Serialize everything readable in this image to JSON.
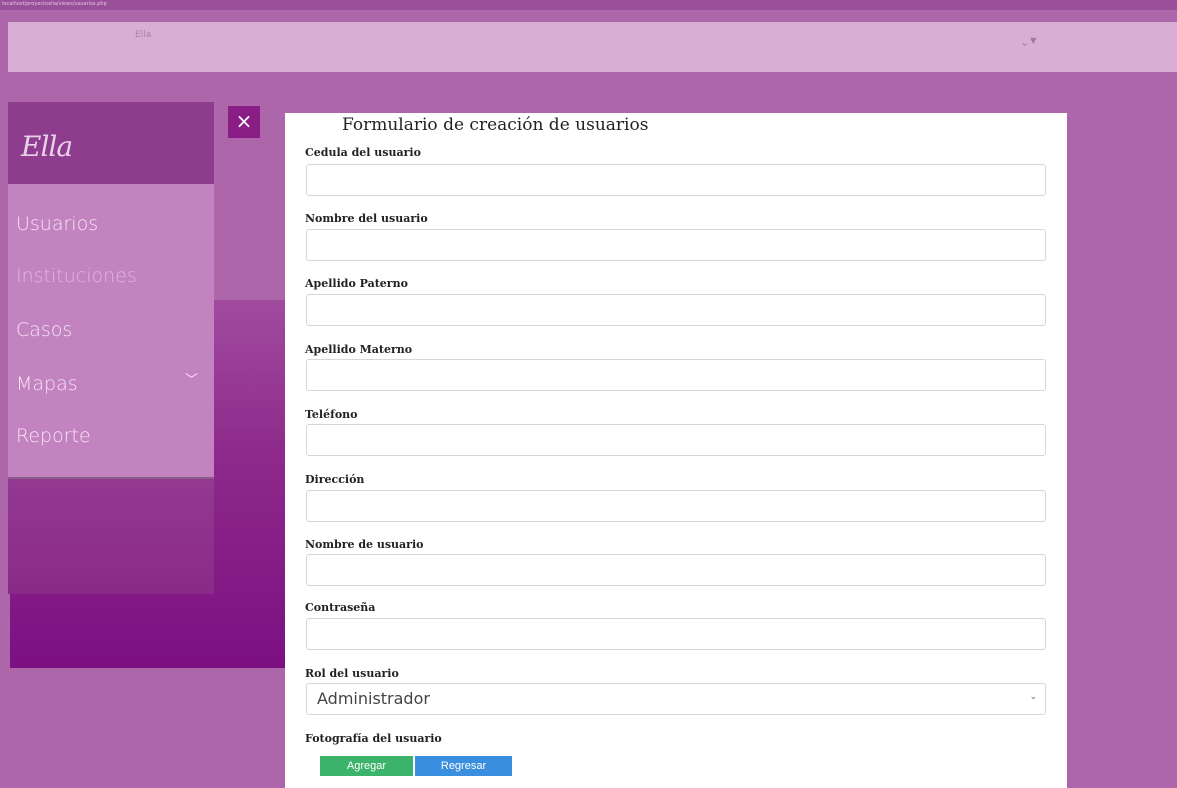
{
  "browser": {
    "url_text": "localhost/proyectoella/views/usuarios.php"
  },
  "header": {
    "brand_small": "Ella",
    "user_menu_icon": "chevron-down-icon",
    "user_menu_caret": "caret-down-icon"
  },
  "sidebar": {
    "logo": "Ella",
    "items": [
      {
        "label": "Usuarios"
      },
      {
        "label": "Instituciones"
      },
      {
        "label": "Casos"
      },
      {
        "label": "Mapas",
        "icon": "chevron-down-icon"
      },
      {
        "label": "Reporte"
      }
    ]
  },
  "close_button": {
    "icon": "close-icon",
    "glyph": "×"
  },
  "form": {
    "title": "Formulario de creación de usuarios",
    "fields": [
      {
        "label": "Cedula del usuario",
        "value": ""
      },
      {
        "label": "Nombre del usuario",
        "value": ""
      },
      {
        "label": "Apellido Paterno",
        "value": ""
      },
      {
        "label": "Apellido Materno",
        "value": ""
      },
      {
        "label": "Teléfono",
        "value": ""
      },
      {
        "label": "Dirección",
        "value": ""
      },
      {
        "label": "Nombre de usuario",
        "value": ""
      },
      {
        "label": "Contraseña",
        "value": ""
      }
    ],
    "role": {
      "label": "Rol del usuario",
      "selected": "Administrador"
    },
    "photo_label": "Fotografía del usuario",
    "buttons": {
      "add": "Agregar",
      "back": "Regresar"
    }
  },
  "colors": {
    "background": "#ad66aa",
    "header": "#d9aed5",
    "sidebar_menu": "#c383c0",
    "close_button": "#8a1d86",
    "add_button": "#3cb36b",
    "back_button": "#3a8ee0"
  }
}
